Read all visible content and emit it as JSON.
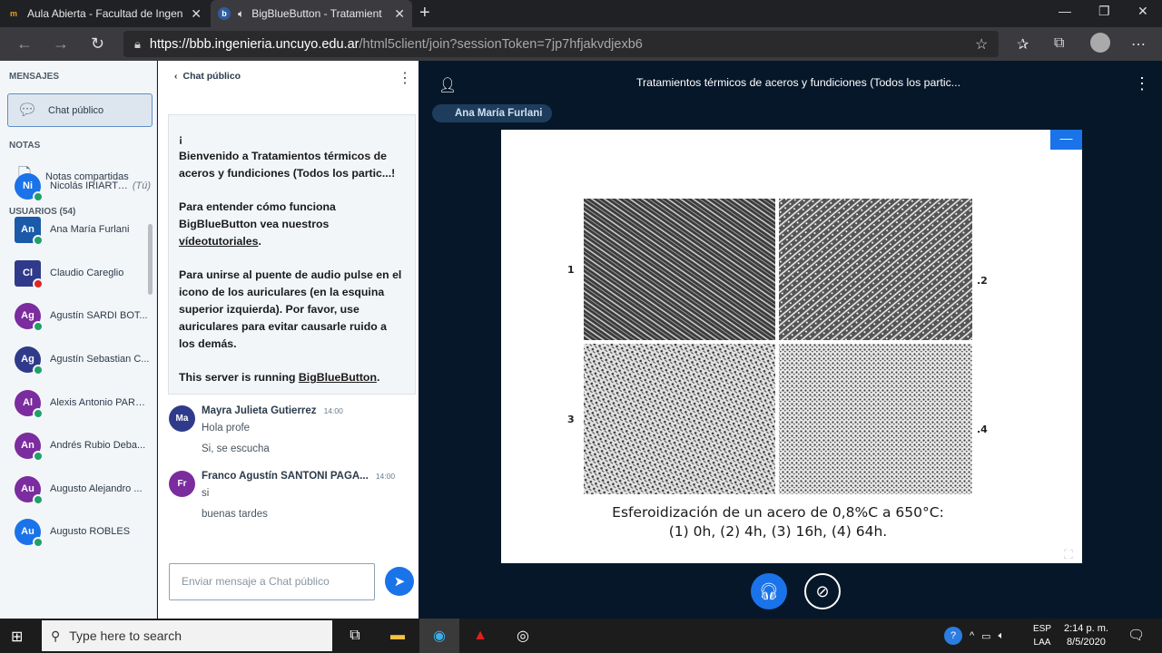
{
  "browser": {
    "tabs": [
      {
        "title": "Aula Abierta - Facultad de Ingen",
        "favicon": "m",
        "icon_color": "#f39c12"
      },
      {
        "title": "BigBlueButton - Tratamient",
        "favicon": "b",
        "icon_color": "#2f5d9e"
      }
    ],
    "url_host": "https://bbb.ingenieria.uncuyo.edu.ar",
    "url_path": "/html5client/join?sessionToken=7jp7hfjakvdjexb6"
  },
  "sidebar": {
    "messages_header": "MENSAJES",
    "public_chat": "Chat público",
    "notes_header": "NOTAS",
    "shared_notes": "Notas compartidas",
    "users_header": "USUARIOS (54)",
    "users": [
      {
        "initials": "Ni",
        "name": "Nicolás IRIART ...",
        "you": "(Tú)",
        "color": "#1a73e8",
        "status": "green",
        "square": false
      },
      {
        "initials": "An",
        "name": "Ana María Furlani",
        "you": "",
        "color": "#1a5aa8",
        "status": "green",
        "square": true
      },
      {
        "initials": "Cl",
        "name": "Claudio Careglio",
        "you": "",
        "color": "#2f3b8a",
        "status": "red",
        "square": true
      },
      {
        "initials": "Ag",
        "name": "Agustín SARDI BOT...",
        "you": "",
        "color": "#7b2c9e",
        "status": "green",
        "square": false
      },
      {
        "initials": "Ag",
        "name": "Agustín Sebastian C...",
        "you": "",
        "color": "#2f3b8a",
        "status": "green",
        "square": false
      },
      {
        "initials": "Al",
        "name": "Alexis Antonio PARA...",
        "you": "",
        "color": "#7b2c9e",
        "status": "green",
        "square": false
      },
      {
        "initials": "An",
        "name": "Andrés Rubio Deba...",
        "you": "",
        "color": "#7b2c9e",
        "status": "green",
        "square": false
      },
      {
        "initials": "Au",
        "name": "Augusto Alejandro ...",
        "you": "",
        "color": "#7b2c9e",
        "status": "green",
        "square": false
      },
      {
        "initials": "Au",
        "name": "Augusto ROBLES",
        "you": "",
        "color": "#1a73e8",
        "status": "green",
        "square": false
      }
    ]
  },
  "chat": {
    "header": "Chat público",
    "welcome": {
      "line0": "¡",
      "p1": "Bienvenido a Tratamientos térmicos de aceros y fundiciones (Todos los partic...!",
      "p2a": "Para entender cómo funciona BigBlueButton vea nuestros ",
      "p2link": "vídeotutoriales",
      "p3": "Para unirse al puente de audio pulse en el icono de los auriculares (en la esquina superior izquierda). Por favor, use auriculares para evitar causarle ruido a los demás.",
      "p4a": "This server is running ",
      "p4link": "BigBlueButton"
    },
    "messages": [
      {
        "initials": "Ma",
        "color": "#2f3b8a",
        "name": "Mayra Julieta Gutierrez",
        "time": "14:00",
        "lines": [
          "Hola profe",
          "Si, se escucha"
        ]
      },
      {
        "initials": "Fr",
        "color": "#7b2c9e",
        "name": "Franco Agustín SANTONI PAGA...",
        "time": "14:00",
        "lines": [
          "si",
          "buenas tardes"
        ]
      }
    ],
    "input_placeholder": "Enviar mensaje a Chat público"
  },
  "presentation": {
    "title": "Tratamientos térmicos de aceros y fundiciones (Todos los partic...",
    "presenter": "Ana María Furlani",
    "panel_labels": [
      "1",
      ".2",
      "3",
      ".4"
    ],
    "caption_line1": "Esferoidización de un acero de 0,8%C a 650°C:",
    "caption_line2": "(1) 0h, (2) 4h, (3) 16h, (4) 64h."
  },
  "taskbar": {
    "search_placeholder": "Type here to search",
    "lang1": "ESP",
    "lang2": "LAA",
    "time": "2:14 p. m.",
    "date": "8/5/2020"
  }
}
